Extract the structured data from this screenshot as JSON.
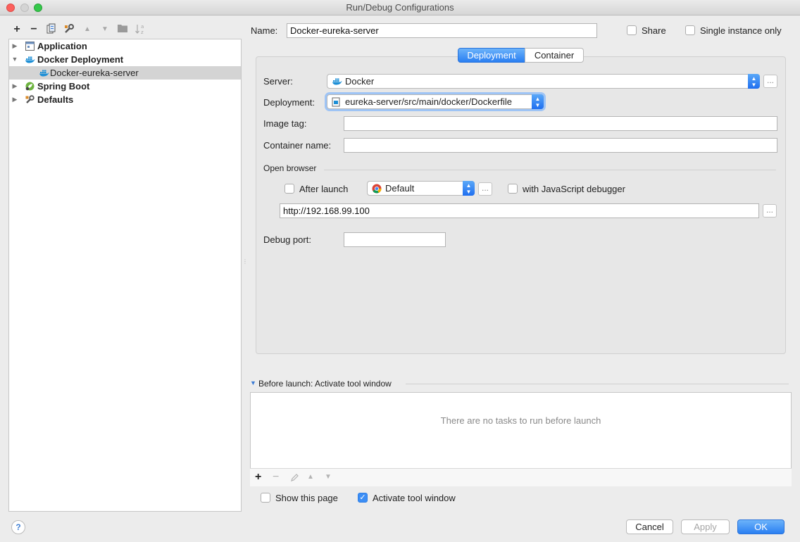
{
  "window": {
    "title": "Run/Debug Configurations"
  },
  "toolbar": {
    "add": "+",
    "remove": "−"
  },
  "tree": {
    "items": [
      {
        "label": "Application",
        "icon": "application-icon"
      },
      {
        "label": "Docker Deployment",
        "icon": "docker-icon"
      },
      {
        "label": "Docker-eureka-server",
        "icon": "docker-icon"
      },
      {
        "label": "Spring Boot",
        "icon": "spring-boot-icon"
      },
      {
        "label": "Defaults",
        "icon": "defaults-wrench-icon"
      }
    ]
  },
  "header": {
    "name_label": "Name:",
    "name_value": "Docker-eureka-server",
    "share_label": "Share",
    "single_instance_label": "Single instance only"
  },
  "tabs": [
    {
      "label": "Deployment",
      "active": true
    },
    {
      "label": "Container",
      "active": false
    }
  ],
  "form": {
    "server_label": "Server:",
    "server_value": "Docker",
    "deployment_label": "Deployment:",
    "deployment_value": "eureka-server/src/main/docker/Dockerfile",
    "image_tag_label": "Image tag:",
    "image_tag_value": "",
    "container_name_label": "Container name:",
    "container_name_value": "",
    "open_browser_label": "Open browser",
    "after_launch_label": "After launch",
    "browser_value": "Default",
    "js_debugger_label": "with JavaScript debugger",
    "url_value": "http://192.168.99.100",
    "debug_port_label": "Debug port:",
    "debug_port_value": "",
    "dots": "..."
  },
  "before_launch": {
    "title": "Before launch: Activate tool window",
    "empty_text": "There are no tasks to run before launch"
  },
  "options": {
    "show_page_label": "Show this page",
    "show_page_checked": false,
    "activate_tool_label": "Activate tool window",
    "activate_tool_checked": true
  },
  "buttons": {
    "help": "?",
    "cancel": "Cancel",
    "apply": "Apply",
    "ok": "OK"
  },
  "colors": {
    "accent": "#2a7ff2",
    "docker_blue": "#1d8fd6",
    "spring_green": "#6db33f"
  }
}
